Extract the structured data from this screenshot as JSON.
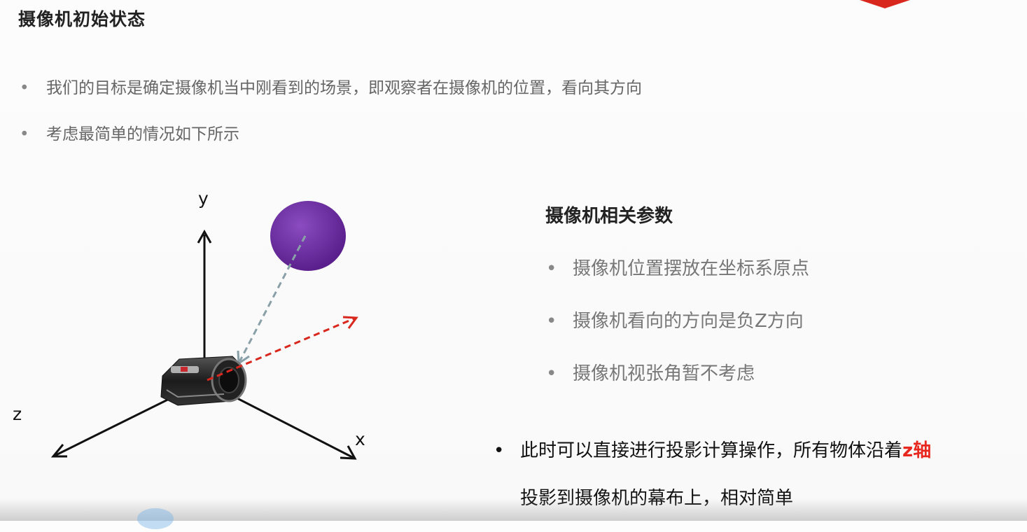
{
  "slide": {
    "title": "摄像机初始状态",
    "bullets": [
      "我们的目标是确定摄像机当中刚看到的场景，即观察者在摄像机的位置，看向其方向",
      "考虑最简单的情况如下所示"
    ],
    "bullet_glyph": "•"
  },
  "diagram": {
    "axes": {
      "y": "y",
      "z": "z",
      "x": "x"
    },
    "colors": {
      "sphere": "#6a2a9e",
      "view_ray": "#8aa0a8",
      "look_direction": "#d8281e",
      "axis": "#111111",
      "camera_body": "#2a2a2a"
    }
  },
  "params": {
    "title": "摄像机相关参数",
    "items": [
      "摄像机位置摆放在坐标系原点",
      "摄像机看向的方向是负Z方向",
      "摄像机视张角暂不考虑"
    ]
  },
  "note": {
    "line1_prefix": "此时可以直接进行投影计算操作，所有物体沿着",
    "line1_highlight": "z轴",
    "line2": "投影到摄像机的幕布上，相对简单",
    "highlight_color": "#e8281e"
  }
}
